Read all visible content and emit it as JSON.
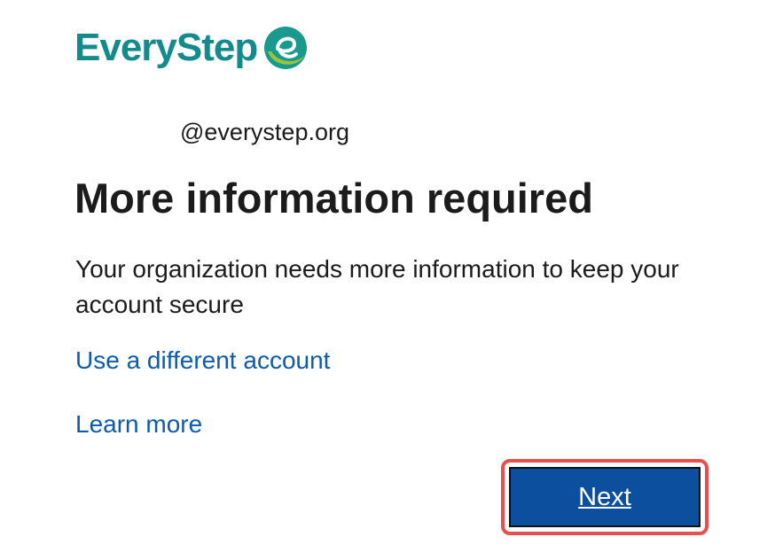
{
  "brand": {
    "name": "EveryStep",
    "logo_icon": "everystep-e-logo-icon",
    "colors": {
      "text": "#138a8c",
      "mark_teal": "#1a9a8f",
      "mark_green": "#9bc33b"
    }
  },
  "account": {
    "email": "@everystep.org"
  },
  "main": {
    "title": "More information required",
    "description": "Your organization needs more information to keep your account secure",
    "use_different_account_link": "Use a different account",
    "learn_more_link": "Learn more"
  },
  "actions": {
    "next_label": "Next",
    "primary_color": "#0b4f9e",
    "highlight_color": "#ea4f4f"
  }
}
